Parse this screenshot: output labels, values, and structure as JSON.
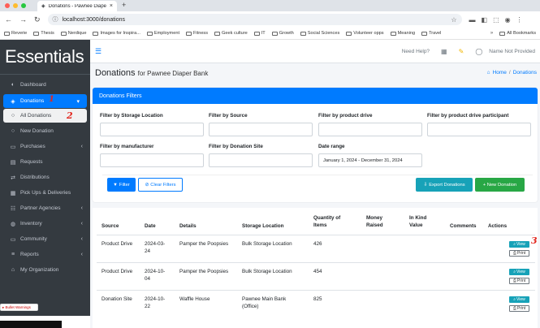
{
  "browser": {
    "tab_title": "Donations - Pawnee Diaper B",
    "url": "localhost:3000/donations",
    "bookmarks": [
      "Reverie",
      "Thesis",
      "Nerdique",
      "Images for Inspira...",
      "Employment",
      "Fitness",
      "Geek culture",
      "IT",
      "Growth",
      "Social Sciences",
      "Volunteer opps",
      "Meaning",
      "Travel"
    ],
    "all_bookmarks": "All Bookmarks",
    "traffic_colors": [
      "#ff5f57",
      "#febc2e",
      "#28c840"
    ]
  },
  "sidebar": {
    "brand": "Essentials",
    "items": [
      {
        "label": "Dashboard",
        "icon": "tachometer-icon",
        "glyph": "◐",
        "chev": ""
      },
      {
        "label": "Donations",
        "icon": "donations-icon",
        "glyph": "◈",
        "chev": "▾"
      },
      {
        "label": "All Donations",
        "icon": "circle-icon",
        "glyph": "○",
        "chev": ""
      },
      {
        "label": "New Donation",
        "icon": "circle-icon",
        "glyph": "○",
        "chev": ""
      },
      {
        "label": "Purchases",
        "icon": "money-icon",
        "glyph": "▭",
        "chev": "‹"
      },
      {
        "label": "Requests",
        "icon": "file-icon",
        "glyph": "▤",
        "chev": ""
      },
      {
        "label": "Distributions",
        "icon": "truck-icon",
        "glyph": "⇄",
        "chev": ""
      },
      {
        "label": "Pick Ups & Deliveries",
        "icon": "calendar-icon",
        "glyph": "▦",
        "chev": ""
      },
      {
        "label": "Partner Agencies",
        "icon": "users-icon",
        "glyph": "☷",
        "chev": "‹"
      },
      {
        "label": "Inventory",
        "icon": "globe-icon",
        "glyph": "◍",
        "chev": "‹"
      },
      {
        "label": "Community",
        "icon": "laptop-icon",
        "glyph": "▭",
        "chev": "‹"
      },
      {
        "label": "Reports",
        "icon": "list-icon",
        "glyph": "≡",
        "chev": "‹"
      },
      {
        "label": "My Organization",
        "icon": "home-icon",
        "glyph": "⌂",
        "chev": ""
      }
    ],
    "bullet_warnings": "▸ Bullet Warnings"
  },
  "annotations": [
    "1",
    "2",
    "3"
  ],
  "topnav": {
    "help": "Need Help?",
    "user": "Name Not Provided"
  },
  "page": {
    "title": "Donations",
    "subtitle": "for Pawnee Diaper Bank",
    "breadcrumb_home": "Home",
    "breadcrumb_sep": "/",
    "breadcrumb_current": "Donations"
  },
  "filters": {
    "header": "Donations Filters",
    "labels": {
      "storage": "Filter by Storage Location",
      "source": "Filter by Source",
      "product_drive": "Filter by product drive",
      "participant": "Filter by product drive participant",
      "manufacturer": "Filter by manufacturer",
      "site": "Filter by Donation Site",
      "date_range": "Date range"
    },
    "date_value": "January 1, 2024 - December 31, 2024",
    "filter_btn": "Filter",
    "clear_btn": "Clear Filters",
    "export_btn": "Export Donations",
    "new_btn": "+ New Donation"
  },
  "table": {
    "headers": [
      "Source",
      "Date",
      "Details",
      "Storage Location",
      "Quantity of Items",
      "Money Raised",
      "In Kind Value",
      "Comments",
      "Actions"
    ],
    "rows": [
      {
        "source": "Product Drive",
        "date": "2024-03-24",
        "details": "Pamper the Poopsies",
        "storage": "Bulk Storage Location",
        "qty": "426"
      },
      {
        "source": "Product Drive",
        "date": "2024-10-04",
        "details": "Pamper the Poopsies",
        "storage": "Bulk Storage Location",
        "qty": "454"
      },
      {
        "source": "Donation Site",
        "date": "2024-10-22",
        "details": "Waffle House",
        "storage": "Pawnee Main Bank (Office)",
        "qty": "825"
      }
    ],
    "view_label": "View",
    "print_label": "Print"
  }
}
